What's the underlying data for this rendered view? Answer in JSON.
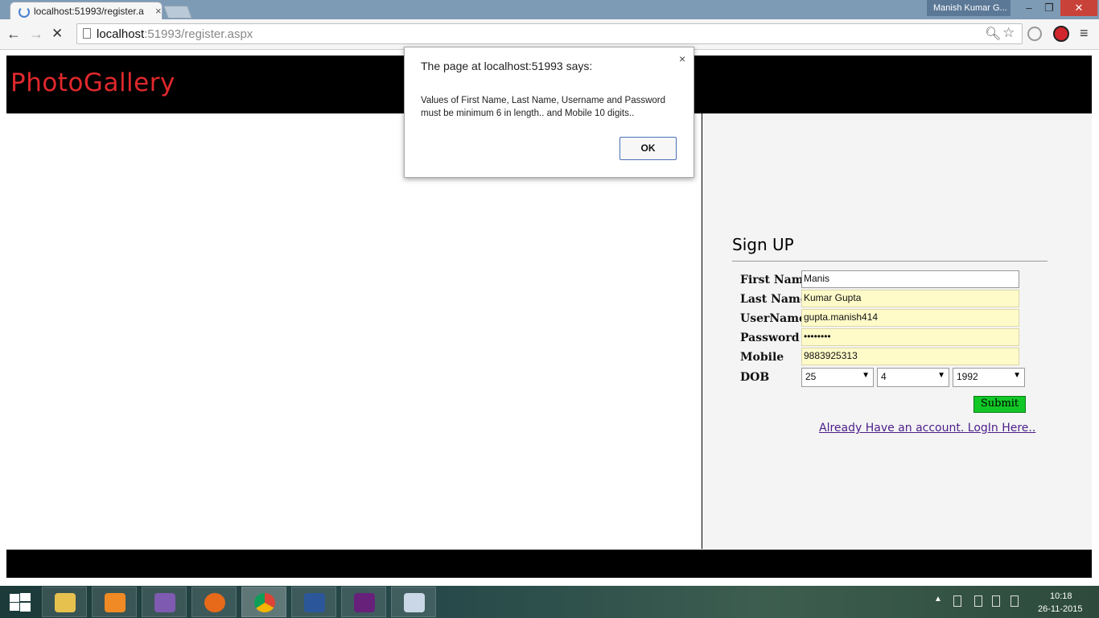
{
  "browser": {
    "tab_title": "localhost:51993/register.a",
    "tab_close": "×",
    "profile_name": "Manish Kumar G...",
    "window_controls": {
      "minimize": "–",
      "restore": "❐",
      "close": "✕"
    },
    "url_host": "localhost",
    "url_path": ":51993/register.aspx",
    "icons": [
      "back-icon",
      "forward-icon",
      "stop-icon",
      "page-icon",
      "zoom-icon",
      "star-icon",
      "extension-icon",
      "extension-icon",
      "menu-icon"
    ]
  },
  "site": {
    "logo": "PhotoGallery",
    "header_color": "#000000",
    "logo_color": "#e0282c"
  },
  "signup": {
    "title": "Sign UP",
    "fields": {
      "first_name": {
        "label": "First Name",
        "value": "Manis"
      },
      "last_name": {
        "label": "Last Name",
        "value": "Kumar Gupta"
      },
      "username": {
        "label": "UserName",
        "value": "gupta.manish414"
      },
      "password": {
        "label": "Password",
        "value": "••••••••"
      },
      "mobile": {
        "label": "Mobile",
        "value": "9883925313"
      }
    },
    "dob": {
      "label": "DOB",
      "day": "25",
      "month": "4",
      "year": "1992"
    },
    "submit": "Submit",
    "login_link": "Already Have an account. LogIn Here..",
    "submit_color": "#11c827"
  },
  "alert": {
    "title": "The page at localhost:51993 says:",
    "message": "Values of First Name, Last Name, Username and Password must be minimum 6 in length.. and Mobile 10 digits..",
    "ok": "OK",
    "close": "×"
  },
  "taskbar": {
    "apps": [
      "file-explorer-icon",
      "media-player-icon",
      "visual-studio-icon",
      "firefox-icon",
      "chrome-icon",
      "word-icon",
      "visual-studio-2015-icon",
      "paint-icon"
    ],
    "time": "10:18",
    "date": "26-11-2015"
  }
}
